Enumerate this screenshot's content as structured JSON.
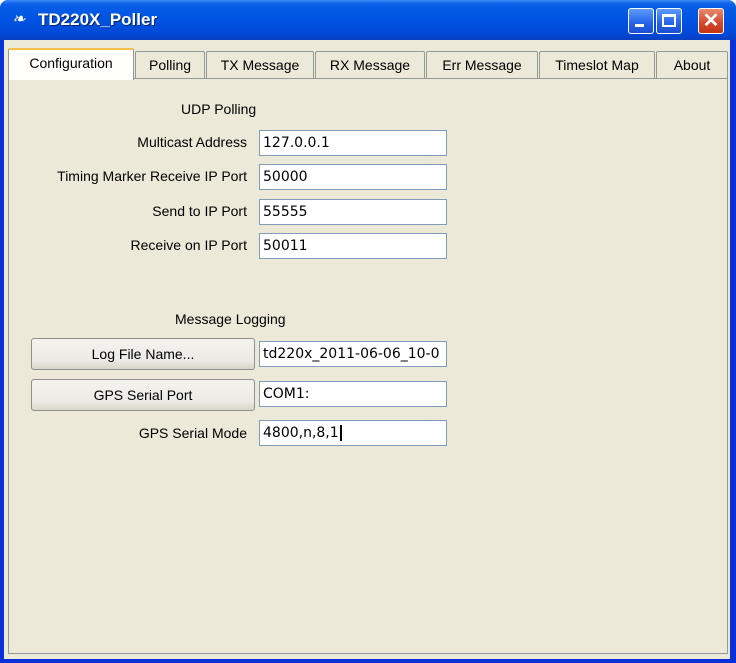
{
  "window": {
    "title": "TD220X_Poller"
  },
  "tabs": [
    {
      "label": "Configuration"
    },
    {
      "label": "Polling"
    },
    {
      "label": "TX Message"
    },
    {
      "label": "RX Message"
    },
    {
      "label": "Err Message"
    },
    {
      "label": "Timeslot Map"
    },
    {
      "label": "About"
    }
  ],
  "udp": {
    "heading": "UDP Polling",
    "multicast_label": "Multicast Address",
    "multicast_value": "127.0.0.1",
    "timing_label": "Timing Marker Receive IP Port",
    "timing_value": "50000",
    "send_label": "Send to IP Port",
    "send_value": "55555",
    "receive_label": "Receive on IP Port",
    "receive_value": "50011"
  },
  "logging": {
    "heading": "Message Logging",
    "log_button": "Log File Name...",
    "log_value": "td220x_2011-06-06_10-0",
    "gps_button": "GPS Serial Port",
    "gps_port_value": "COM1:",
    "gps_mode_label": "GPS Serial Mode",
    "gps_mode_value": "4800,n,8,1"
  }
}
